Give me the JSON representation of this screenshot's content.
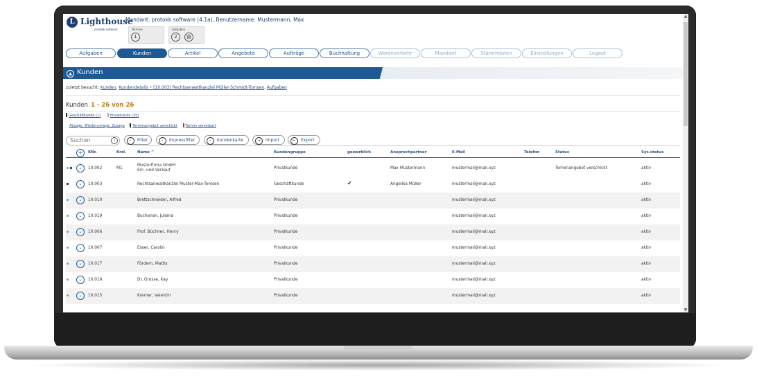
{
  "app": {
    "brand": "Lighthouse",
    "brand_sub": "protokk software",
    "mandant_line": "Mandant: protokk software (4.1a), Benutzername: Mustermann, Max"
  },
  "mini_boxes": [
    {
      "title": "Termine",
      "count": "1"
    },
    {
      "title": "Aufgaben",
      "count": "2"
    }
  ],
  "nav": [
    {
      "label": "Aufgaben"
    },
    {
      "label": "Kunden"
    },
    {
      "label": "Artikel"
    },
    {
      "label": "Angebote"
    },
    {
      "label": "Aufträge"
    },
    {
      "label": "Buchhaltung"
    },
    {
      "label": "Warenverkehr"
    },
    {
      "label": "Mandant"
    },
    {
      "label": "Stammdaten"
    },
    {
      "label": "Einstellungen"
    },
    {
      "label": "Logout"
    }
  ],
  "page": {
    "title": "Kunden",
    "visited_label": "zuletzt besucht:",
    "visited": [
      "Kunden",
      "Kundendetails • [10.003] Rechtsanwaltkanzlei Müller-Schmidt-Tomsen",
      "Aufgaben"
    ],
    "heading": "Kunden",
    "range": "1 - 26 von 26",
    "filters_group": [
      "Geschäftkunde (1)",
      "Privatkunde (25)"
    ],
    "filters_status": [
      "Absage, Wiedervorlage, Zusage",
      "Terminangebot verschickt",
      "Termin vereinbart"
    ],
    "colors": {
      "accent": "#1d5a94",
      "range": "#c07a1a"
    }
  },
  "toolbar": {
    "search_placeholder": "Suchen",
    "buttons": [
      "Filter",
      "Expressfilter",
      "Kundenkarte",
      "Import",
      "Export"
    ]
  },
  "table": {
    "columns": [
      "KNr.",
      "Krzl.",
      "Name ^",
      "Kundengruppe",
      "gewerblich",
      "Ansprechpartner",
      "E-Mail",
      "Telefon",
      "Status",
      "Sys.status"
    ],
    "rows": [
      {
        "knr": "10.002",
        "krzl": "M1",
        "name": "Musterfirma GmbH",
        "name2": "Ein- und Verkauf",
        "gruppe": "Privatkunde",
        "gewerblich": "",
        "ansprech": "Max Mustermann",
        "email": "mustermail@mail.xyz",
        "telefon": "",
        "status": "Terminangebot verschickt",
        "sys": "aktiv"
      },
      {
        "knr": "10.003",
        "krzl": "",
        "name": "Rechtsanwaltkanzlei Muster-Max-Tomsen",
        "name2": "",
        "gruppe": "Geschäftkunde",
        "gewerblich": "✔",
        "ansprech": "Angelika Müller",
        "email": "mustermail@mail.xyz",
        "telefon": "",
        "status": "",
        "sys": "aktiv"
      },
      {
        "knr": "10.010",
        "krzl": "",
        "name": "Brettschneider, Alfred",
        "name2": "",
        "gruppe": "Privatkunde",
        "gewerblich": "",
        "ansprech": "",
        "email": "mustermail@mail.xyz",
        "telefon": "",
        "status": "",
        "sys": "aktiv"
      },
      {
        "knr": "10.019",
        "krzl": "",
        "name": "Buchanan, Juliana",
        "name2": "",
        "gruppe": "Privatkunde",
        "gewerblich": "",
        "ansprech": "",
        "email": "mustermail@mail.xyz",
        "telefon": "",
        "status": "",
        "sys": "aktiv"
      },
      {
        "knr": "10.006",
        "krzl": "",
        "name": "Prof. Büchner, Henry",
        "name2": "",
        "gruppe": "Privatkunde",
        "gewerblich": "",
        "ansprech": "",
        "email": "mustermail@mail.xyz",
        "telefon": "",
        "status": "",
        "sys": "aktiv"
      },
      {
        "knr": "10.007",
        "krzl": "",
        "name": "Esser, Carolin",
        "name2": "",
        "gruppe": "Privatkunde",
        "gewerblich": "",
        "ansprech": "",
        "email": "mustermail@mail.xyz",
        "telefon": "",
        "status": "",
        "sys": "aktiv"
      },
      {
        "knr": "10.017",
        "krzl": "",
        "name": "Fördern, Mattis",
        "name2": "",
        "gruppe": "Privatkunde",
        "gewerblich": "",
        "ansprech": "",
        "email": "mustermail@mail.xyz",
        "telefon": "",
        "status": "",
        "sys": "aktiv"
      },
      {
        "knr": "10.018",
        "krzl": "",
        "name": "Dr. Grosse, Kay",
        "name2": "",
        "gruppe": "Privatkunde",
        "gewerblich": "",
        "ansprech": "",
        "email": "mustermail@mail.xyz",
        "telefon": "",
        "status": "",
        "sys": "aktiv"
      },
      {
        "knr": "10.015",
        "krzl": "",
        "name": "Kremer, Valentin",
        "name2": "",
        "gruppe": "Privatkunde",
        "gewerblich": "",
        "ansprech": "",
        "email": "mustermail@mail.xyz",
        "telefon": "",
        "status": "",
        "sys": "aktiv"
      }
    ]
  }
}
